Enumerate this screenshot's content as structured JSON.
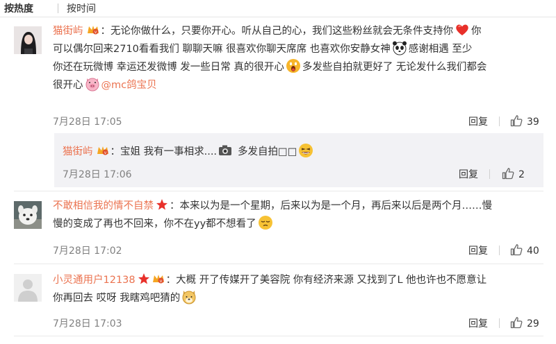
{
  "tabs": [
    {
      "label": "按热度"
    },
    {
      "label": "按时间"
    }
  ],
  "comments": [
    {
      "username": "猫街屿",
      "text_lines": [
        "：无论你做什么，只要你开心。听从自己的心，我们这些粉丝就会无条件支持你",
        "可以偶尔回来2710看看我们  聊聊天嘛  很喜欢你聊天席席  也喜欢你安静女神",
        "感谢相遇  至少",
        "你还在玩微博  幸运还发微博  发一些日常  真的很开心",
        "多发些自拍就更好了  无论发什么我们都会",
        "很开心"
      ],
      "mention": "@mc鸽宝贝",
      "time": "7月28日 17:05",
      "reply_label": "回复",
      "like_count": "39",
      "reply": {
        "username": "猫街屿",
        "text": "：宝姐 我有一事相求....",
        "text2": "多发自拍□□",
        "time": "7月28日 17:06",
        "reply_label": "回复",
        "like_count": "2"
      }
    },
    {
      "username": "不敢相信我的情不自禁",
      "text_lines": [
        "：本来以为是一个星期，后来以为是一个月，再后来以后是两个月……慢",
        "慢的变成了再也不回来，你不在yy都不想看了"
      ],
      "time": "7月28日 17:02",
      "reply_label": "回复",
      "like_count": "40"
    },
    {
      "username": "小灵通用户12138",
      "text_lines": [
        "：大概 开了传媒开了美容院 你有经济来源 又找到了L 他也许也不愿意让",
        "你再回去 哎呀 我瞎鸡吧猜的"
      ],
      "time": "7月28日 17:03",
      "reply_label": "回复",
      "like_count": "29"
    }
  ],
  "icons": {
    "badge": "vip-crown-badge-icon",
    "heart": "heart-emoji-icon",
    "panda": "panda-emoji-icon",
    "scream": "scream-emoji-icon",
    "pig": "pig-emoji-icon",
    "camera": "camera-icon",
    "laugh": "laugh-emoji-icon",
    "star": "red-star-icon",
    "sleepy": "sleepy-emoji-icon",
    "dog": "dog-emoji-icon",
    "like": "thumbs-up-icon"
  },
  "colors": {
    "username": "#eb7350",
    "text": "#333333",
    "time": "#808080",
    "reply_bg": "#f2f2f5"
  }
}
